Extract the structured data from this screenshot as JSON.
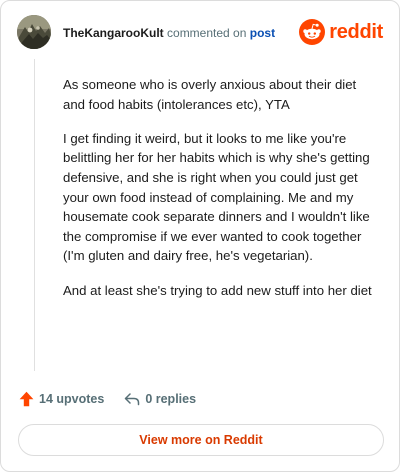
{
  "header": {
    "username": "TheKangarooKult",
    "commented_text": "commented on",
    "post_link": "post",
    "brand": "reddit"
  },
  "comment": {
    "paragraphs": [
      "As someone who is overly anxious about their diet and food habits (intolerances etc), YTA",
      "I get finding it weird, but it looks to me like you're belittling her for her habits which is why she's getting defensive, and she is right when you could just get your own food instead of complaining. Me and my housemate cook separate dinners and I wouldn't like the compromise if we ever wanted to cook together (I'm gluten and dairy free, he's vegetarian).",
      "And at least she's trying to add new stuff into her diet"
    ]
  },
  "actions": {
    "upvotes": "14 upvotes",
    "replies": "0 replies"
  },
  "footer": {
    "view_more": "View more on Reddit"
  },
  "colors": {
    "accent": "#ff4500",
    "link": "#0a4fb3",
    "muted": "#576f76",
    "view_more": "#d93a00"
  },
  "icons": {
    "upvote": "upvote-arrow-icon",
    "reply": "reply-arrow-icon",
    "brand": "reddit-snoo-icon"
  }
}
